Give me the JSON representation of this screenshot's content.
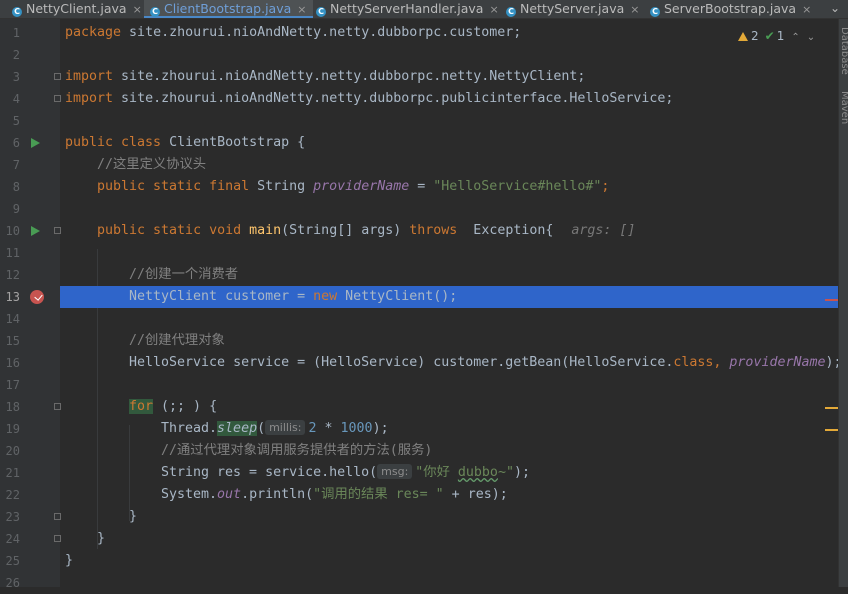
{
  "tabs": [
    {
      "label": "NettyClient.java",
      "active": false
    },
    {
      "label": "ClientBootstrap.java",
      "active": true
    },
    {
      "label": "NettyServerHandler.java",
      "active": false
    },
    {
      "label": "NettyServer.java",
      "active": false
    },
    {
      "label": "ServerBootstrap.java",
      "active": false
    }
  ],
  "tab_close_glyph": "×",
  "tab_more_glyph": "⌄",
  "inspection": {
    "warnings": "2",
    "ok": "1"
  },
  "sidebar": {
    "top_label": "Database",
    "bottom_label": "Maven"
  },
  "gutter": {
    "line_numbers": [
      "1",
      "2",
      "3",
      "4",
      "5",
      "6",
      "7",
      "8",
      "9",
      "10",
      "11",
      "12",
      "13",
      "14",
      "15",
      "16",
      "17",
      "18",
      "19",
      "20",
      "21",
      "22",
      "23",
      "24",
      "25",
      "26"
    ],
    "current_line": "13"
  },
  "code": {
    "l1": {
      "kw": "package",
      "rest": " site.zhourui.nioAndNetty.netty.dubborpc.customer;"
    },
    "l3": {
      "kw": "import",
      "rest": " site.zhourui.nioAndNetty.netty.dubborpc.netty.NettyClient;"
    },
    "l4": {
      "kw": "import",
      "rest": " site.zhourui.nioAndNetty.netty.dubborpc.publicinterface.HelloService;"
    },
    "l6": {
      "kw": "public class",
      "rest": " ClientBootstrap {"
    },
    "l7": {
      "comment": "//这里定义协议头"
    },
    "l8": {
      "kw": "public static final",
      "type": " String ",
      "field": "providerName",
      "eq": " = ",
      "str": "\"HelloService#hello#\"",
      "end": ";"
    },
    "l10": {
      "kw": "public static void",
      "fn": "main",
      "params": "(String[] args) ",
      "kw2": "throws",
      "rest": "  Exception{",
      "hint": "args: []"
    },
    "l12": {
      "comment": "//创建一个消费者"
    },
    "l13": {
      "a": "NettyClient customer = ",
      "kw": "new",
      "b": " NettyClient();"
    },
    "l15": {
      "comment": "//创建代理对象"
    },
    "l16": {
      "a": "HelloService service = (HelloService) customer.getBean(HelloService.",
      "kw": "class",
      "b": ", ",
      "field": "providerName",
      "c": ");"
    },
    "l18": {
      "kw": "for",
      "rest": " (;; ) {"
    },
    "l19": {
      "a": "Thread.",
      "fn": "sleep",
      "b": "(",
      "hint": "millis:",
      "num1": "2",
      "op": " * ",
      "num2": "1000",
      "c": ");"
    },
    "l20": {
      "comment": "//通过代理对象调用服务提供者的方法(服务)"
    },
    "l21": {
      "a": "String res = service.hello(",
      "hint": "msg:",
      "str1": "\"你好 ",
      "typo": "dubbo",
      "str2": "~\"",
      "c": ");"
    },
    "l22": {
      "a": "System.",
      "field": "out",
      "b": ".println(",
      "str": "\"调用的结果 res= \"",
      "c": " + res);"
    },
    "l23": {
      "brace": "}"
    },
    "l24": {
      "brace": "}"
    },
    "l25": {
      "brace": "}"
    }
  },
  "colors": {
    "background": "#2b2b2b",
    "keyword": "#cc7832",
    "string": "#6a8759",
    "comment": "#808080",
    "field": "#9876aa",
    "method": "#ffc66d",
    "number": "#6897bb",
    "current_line_highlight": "#2f65ca",
    "run_marker": "#499c54",
    "breakpoint": "#c75450",
    "warning": "#e3a938"
  }
}
